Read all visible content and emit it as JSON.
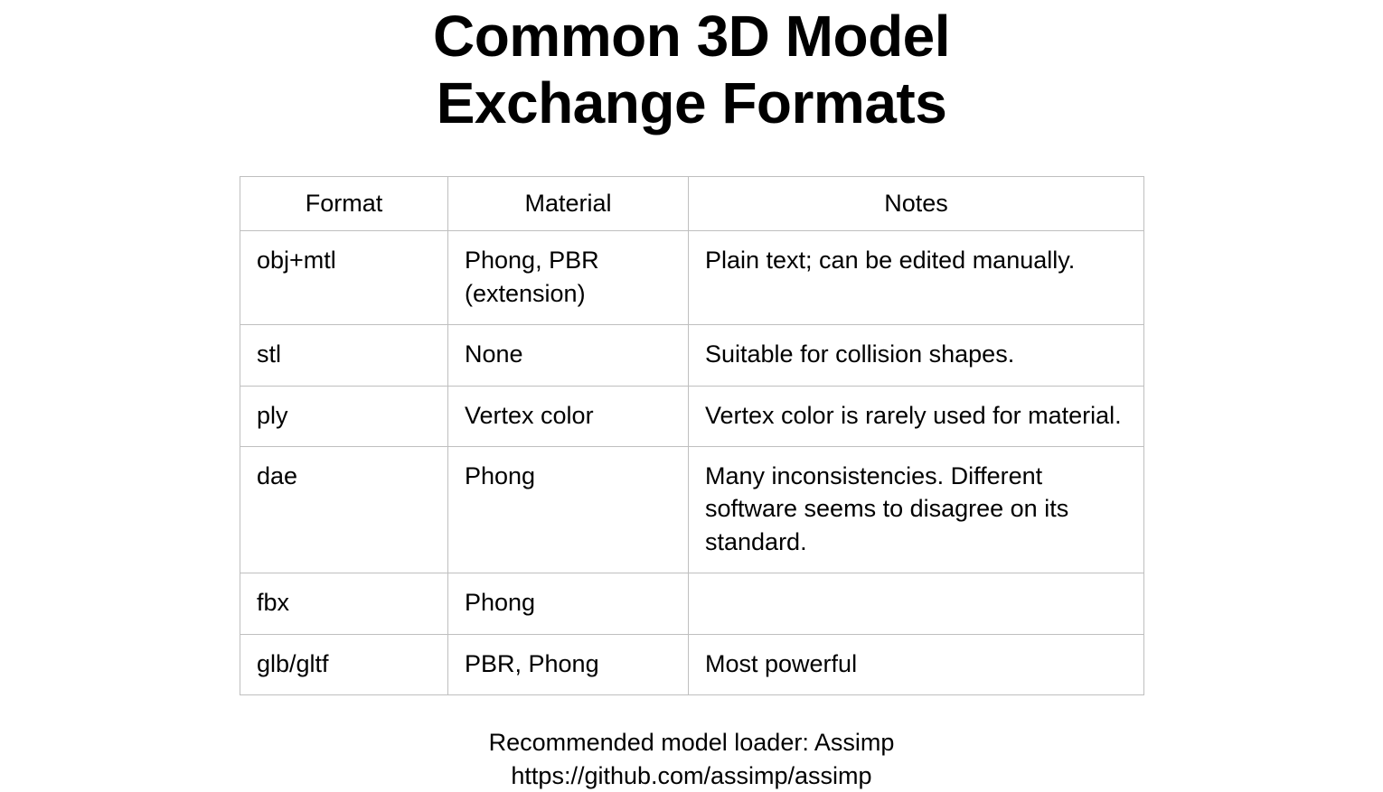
{
  "title_line1": "Common 3D Model",
  "title_line2": "Exchange Formats",
  "chart_data": {
    "type": "table",
    "columns": [
      "Format",
      "Material",
      "Notes"
    ],
    "rows": [
      {
        "format": "obj+mtl",
        "material": "Phong, PBR (extension)",
        "notes": "Plain text; can be edited manually."
      },
      {
        "format": "stl",
        "material": "None",
        "notes": "Suitable for collision shapes."
      },
      {
        "format": "ply",
        "material": "Vertex color",
        "notes": "Vertex color is rarely used for material."
      },
      {
        "format": "dae",
        "material": "Phong",
        "notes": "Many inconsistencies. Different software seems to disagree on its standard."
      },
      {
        "format": "fbx",
        "material": "Phong",
        "notes": ""
      },
      {
        "format": "glb/gltf",
        "material": "PBR, Phong",
        "notes": "Most powerful"
      }
    ]
  },
  "footer_line1": "Recommended model loader: Assimp",
  "footer_line2": "https://github.com/assimp/assimp"
}
